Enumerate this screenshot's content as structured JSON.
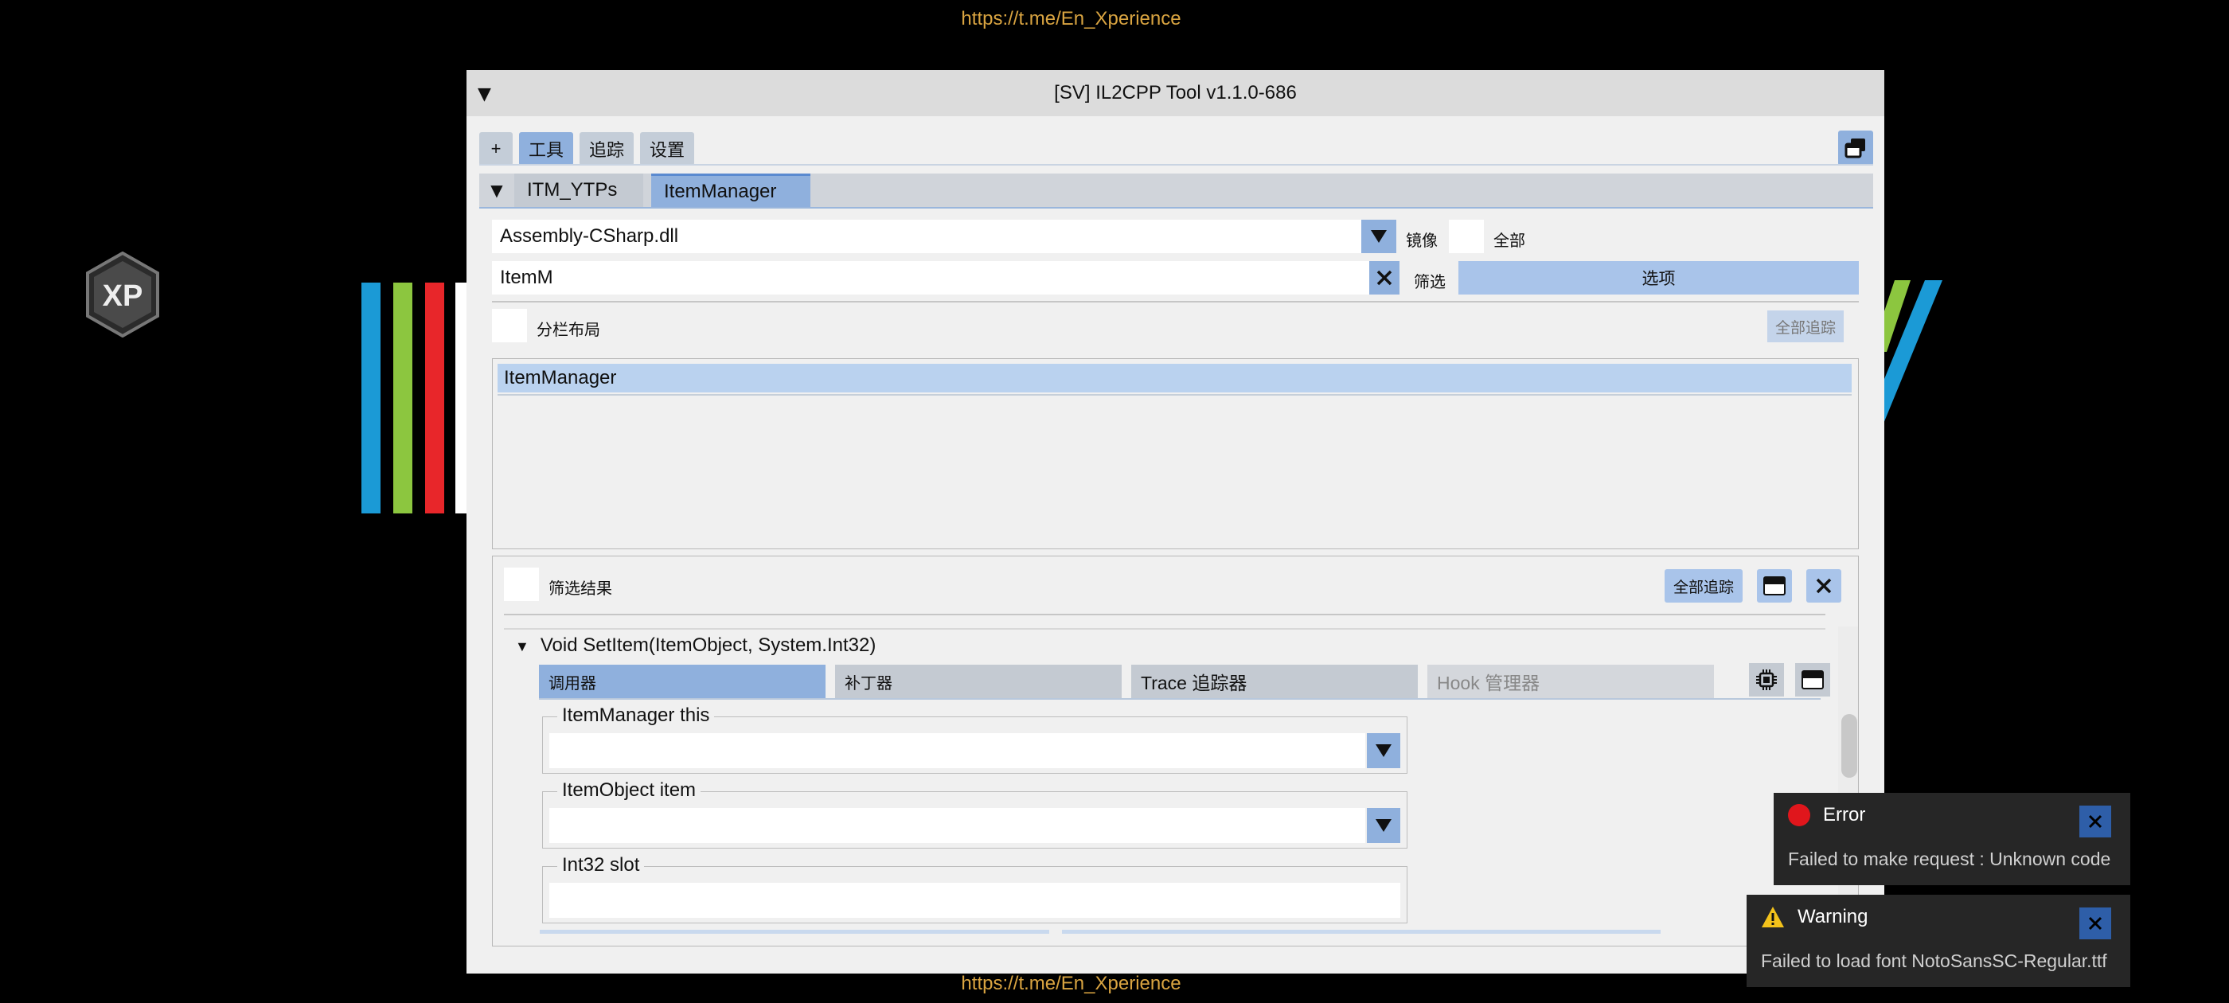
{
  "overlay": {
    "url_top": "https://t.me/En_Xperience",
    "url_bottom": "https://t.me/En_Xperience",
    "logo_text": "XP"
  },
  "window": {
    "title": "[SV] IL2CPP Tool v1.1.0-686",
    "top_tabs": [
      "+",
      "工具",
      "追踪",
      "设置"
    ],
    "sub_tabs": [
      "ITM_YTPs",
      "ItemManager"
    ],
    "assembly": {
      "value": "Assembly-CSharp.dll",
      "mirror_label": "镜像",
      "all_label": "全部"
    },
    "search": {
      "value": "ItemM",
      "filter_label": "筛选",
      "options_label": "选项"
    },
    "split_layout_label": "分栏布局",
    "trace_all_label": "全部追踪",
    "class_list": [
      "ItemManager"
    ],
    "results": {
      "filter_results_label": "筛选结果",
      "trace_all_label": "全部追踪",
      "method": "Void SetItem(ItemObject, System.Int32)",
      "tabs": [
        "调用器",
        "补丁器",
        "Trace 追踪器",
        "Hook 管理器"
      ],
      "params": [
        {
          "label": "ItemManager this",
          "value": ""
        },
        {
          "label": "ItemObject item",
          "value": ""
        },
        {
          "label": "Int32 slot",
          "value": ""
        }
      ]
    }
  },
  "toasts": [
    {
      "type": "Error",
      "message": "Failed to make request : Unknown code"
    },
    {
      "type": "Warning",
      "message": "Failed to load font NotoSansSC-Regular.ttf"
    }
  ],
  "colors": {
    "accent": "#8fb0dd",
    "selection": "#bad2ef",
    "error": "#e0161c",
    "warning": "#f3c21b",
    "link": "#d9a441"
  }
}
